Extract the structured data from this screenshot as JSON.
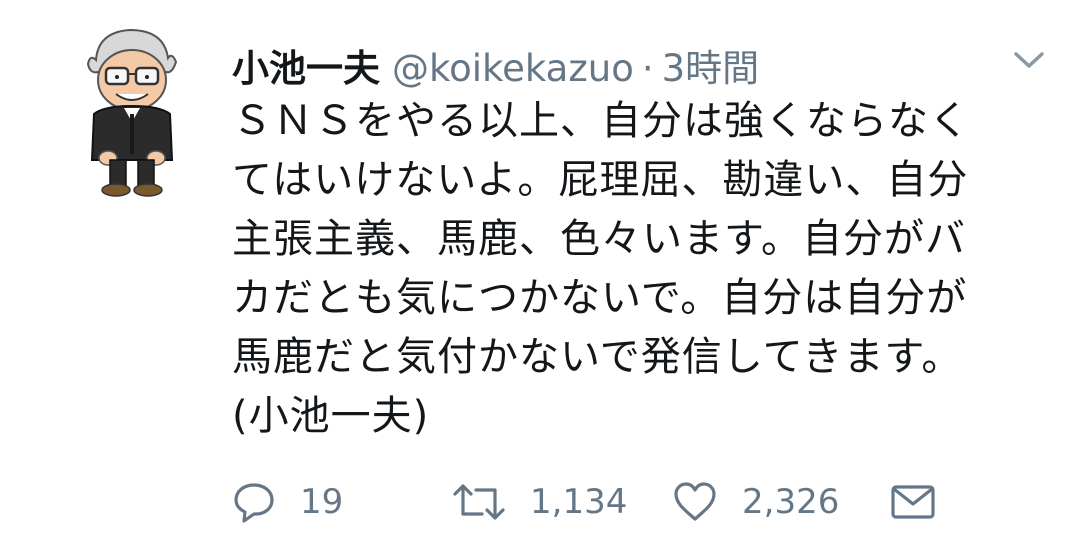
{
  "tweet": {
    "display_name": "小池一夫",
    "handle": "@koikekazuo",
    "separator": "·",
    "time": "3時間",
    "lines": [
      "ＳＮＳをやる以上、自分は強くならなく",
      "てはいけないよ。屁理屈、勘違い、自分",
      "主張主義、馬鹿、色々います。自分がバ",
      "カだとも気につかないで。自分は自分が",
      "馬鹿だと気付かないで発信してきます。",
      "(小池一夫)"
    ]
  },
  "actions": {
    "reply_icon": "reply-icon",
    "reply_count": "19",
    "retweet_icon": "retweet-icon",
    "retweet_count": "1,134",
    "like_icon": "heart-icon",
    "like_count": "2,326",
    "dm_icon": "envelope-icon"
  },
  "colors": {
    "text": "#14171a",
    "muted": "#657786"
  }
}
